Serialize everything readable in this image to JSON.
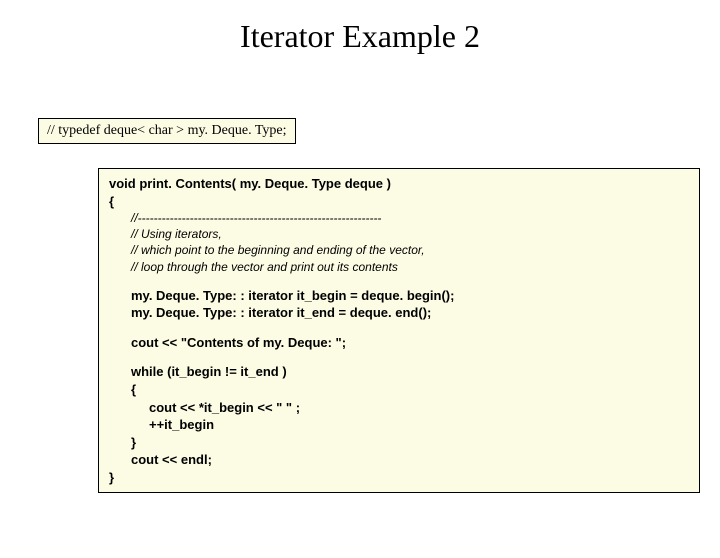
{
  "title": "Iterator Example 2",
  "typedef": "// typedef deque< char > my. Deque. Type;",
  "code": {
    "sig": "void print. Contents( my. Deque. Type deque )",
    "open": "{",
    "c1": "//-------------------------------------------------------------",
    "c2": "// Using iterators,",
    "c3": "// which point to the beginning and ending of the vector,",
    "c4": "// loop through the vector and print out its contents",
    "l1": "my. Deque. Type: : iterator it_begin = deque. begin();",
    "l2": "my. Deque. Type: : iterator it_end   = deque. end();",
    "l3": "cout << \"Contents of my. Deque: \";",
    "l4": "while (it_begin != it_end )",
    "l5": "{",
    "l6": "cout << *it_begin << \" \" ;",
    "l7": "++it_begin",
    "l8": "}",
    "l9": "cout << endl;",
    "close": "}"
  }
}
